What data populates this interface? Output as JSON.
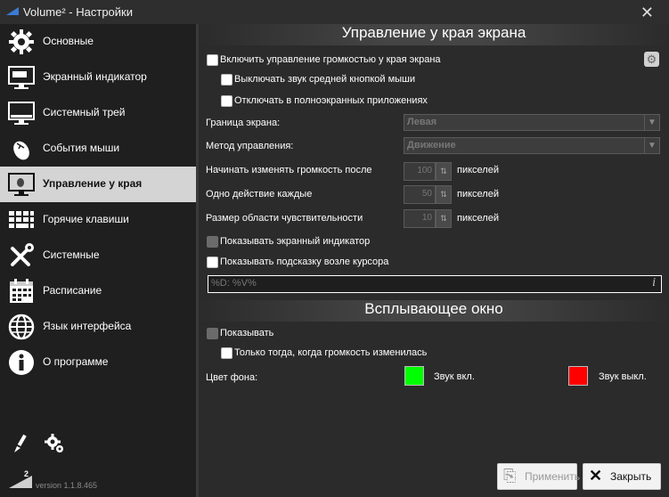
{
  "window": {
    "title": "Volume² - Настройки",
    "close_glyph": "✕"
  },
  "sidebar": {
    "items": [
      {
        "label": "Основные",
        "icon": "gear-icon"
      },
      {
        "label": "Экранный индикатор",
        "icon": "monitor-indicator-icon"
      },
      {
        "label": "Системный трей",
        "icon": "tray-icon"
      },
      {
        "label": "События мыши",
        "icon": "mouse-icon"
      },
      {
        "label": "Управление у края",
        "icon": "screen-edge-icon",
        "selected": true
      },
      {
        "label": "Горячие клавиши",
        "icon": "keyboard-icon"
      },
      {
        "label": "Системные",
        "icon": "tools-icon"
      },
      {
        "label": "Расписание",
        "icon": "calendar-icon"
      },
      {
        "label": "Язык интерфейса",
        "icon": "globe-icon"
      },
      {
        "label": "О программе",
        "icon": "info-icon"
      }
    ],
    "version": "version 1.1.8.465",
    "logo_sup": "2"
  },
  "edge": {
    "header": "Управление у края экрана",
    "enable_label": "Включить управление громкостью у края экрана",
    "mute_middle_label": "Выключать звук средней кнопкой мыши",
    "disable_fullscreen_label": "Отключать в полноэкранных приложениях",
    "border_label": "Граница экрана:",
    "border_value": "Левая",
    "method_label": "Метод управления:",
    "method_value": "Движение",
    "start_label": "Начинать изменять громкость после",
    "start_value": "100",
    "step_label": "Одно действие каждые",
    "step_value": "50",
    "area_label": "Размер области чувствительности",
    "area_value": "10",
    "unit": "пикселей",
    "show_osd_label": "Показывать экранный индикатор",
    "show_tip_label": "Показывать подсказку возле курсора",
    "tip_format": "%D: %V%"
  },
  "popup": {
    "header": "Всплывающее окно",
    "show_label": "Показывать",
    "only_changed_label": "Только тогда, когда громкость изменилась",
    "bg_label": "Цвет фона:",
    "sound_on_label": "Звук вкл.",
    "sound_off_label": "Звук выкл.",
    "color_on": "#00ff00",
    "color_off": "#ff0000"
  },
  "buttons": {
    "apply": "Применить",
    "close": "Закрыть"
  }
}
